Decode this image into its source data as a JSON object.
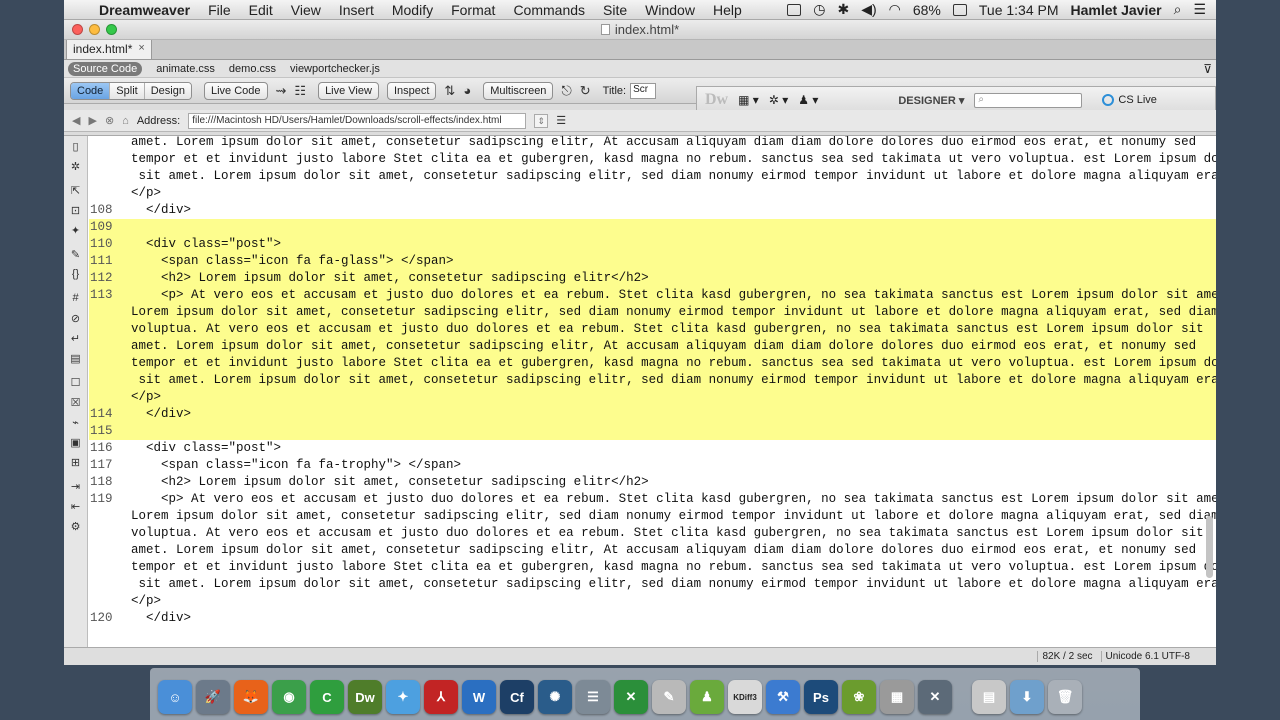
{
  "menubar": {
    "apple": "",
    "app": "Dreamweaver",
    "items": [
      "File",
      "Edit",
      "View",
      "Insert",
      "Modify",
      "Format",
      "Commands",
      "Site",
      "Window",
      "Help"
    ],
    "battery": "68%",
    "clock": "Tue 1:34 PM",
    "user": "Hamlet Javier"
  },
  "window": {
    "title": "index.html*",
    "tab": "index.html*",
    "tab_close": "×",
    "related_files": [
      "Source Code",
      "animate.css",
      "demo.css",
      "viewportchecker.js"
    ],
    "view_buttons": [
      "Code",
      "Split",
      "Design"
    ],
    "live_code": "Live Code",
    "live_view": "Live View",
    "inspect": "Inspect",
    "multiscreen": "Multiscreen",
    "title_label": "Title:",
    "title_value": "Scr",
    "address_label": "Address:",
    "address": "file:///Macintosh HD/Users/Hamlet/Downloads/scroll-effects/index.html"
  },
  "appbar": {
    "logo": "Dw",
    "workspace": "DESIGNER ▾",
    "search_placeholder": "",
    "cs_live": "CS Live"
  },
  "code_lines": [
    {
      "num": "",
      "text": "amet. Lorem ipsum dolor sit amet, consetetur sadipscing elitr, At accusam aliquyam diam diam dolore dolores duo eirmod eos erat, et nonumy sed",
      "hl": false,
      "cont": true
    },
    {
      "num": "",
      "text": "tempor et et invidunt justo labore Stet clita ea et gubergren, kasd magna no rebum. sanctus sea sed takimata ut vero voluptua. est Lorem ipsum dolor",
      "hl": false,
      "cont": true
    },
    {
      "num": "",
      "text": " sit amet. Lorem ipsum dolor sit amet, consetetur sadipscing elitr, sed diam nonumy eirmod tempor invidunt ut labore et dolore magna aliquyam erat.",
      "hl": false,
      "cont": true
    },
    {
      "num": "",
      "text": "</p>",
      "hl": false,
      "cont": true
    },
    {
      "num": "108",
      "text": "  </div>",
      "hl": false,
      "cont": false
    },
    {
      "num": "109",
      "text": "",
      "hl": true,
      "cont": false
    },
    {
      "num": "110",
      "text": "  <div class=\"post\">",
      "hl": true,
      "cont": false
    },
    {
      "num": "111",
      "text": "    <span class=\"icon fa fa-glass\"> </span>",
      "hl": true,
      "cont": false
    },
    {
      "num": "112",
      "text": "    <h2> Lorem ipsum dolor sit amet, consetetur sadipscing elitr</h2>",
      "hl": true,
      "cont": false
    },
    {
      "num": "113",
      "text": "    <p> At vero eos et accusam et justo duo dolores et ea rebum. Stet clita kasd gubergren, no sea takimata sanctus est Lorem ipsum dolor sit amet.",
      "hl": true,
      "cont": false
    },
    {
      "num": "",
      "text": "Lorem ipsum dolor sit amet, consetetur sadipscing elitr, sed diam nonumy eirmod tempor invidunt ut labore et dolore magna aliquyam erat, sed diam",
      "hl": true,
      "cont": true
    },
    {
      "num": "",
      "text": "voluptua. At vero eos et accusam et justo duo dolores et ea rebum. Stet clita kasd gubergren, no sea takimata sanctus est Lorem ipsum dolor sit",
      "hl": true,
      "cont": true
    },
    {
      "num": "",
      "text": "amet. Lorem ipsum dolor sit amet, consetetur sadipscing elitr, At accusam aliquyam diam diam dolore dolores duo eirmod eos erat, et nonumy sed",
      "hl": true,
      "cont": true
    },
    {
      "num": "",
      "text": "tempor et et invidunt justo labore Stet clita ea et gubergren, kasd magna no rebum. sanctus sea sed takimata ut vero voluptua. est Lorem ipsum dolor",
      "hl": true,
      "cont": true
    },
    {
      "num": "",
      "text": " sit amet. Lorem ipsum dolor sit amet, consetetur sadipscing elitr, sed diam nonumy eirmod tempor invidunt ut labore et dolore magna aliquyam erat.",
      "hl": true,
      "cont": true
    },
    {
      "num": "",
      "text": "</p>",
      "hl": true,
      "cont": true
    },
    {
      "num": "114",
      "text": "  </div>",
      "hl": true,
      "cont": false
    },
    {
      "num": "115",
      "text": "",
      "hl": true,
      "cont": false
    },
    {
      "num": "116",
      "text": "  <div class=\"post\">",
      "hl": false,
      "cont": false
    },
    {
      "num": "117",
      "text": "    <span class=\"icon fa fa-trophy\"> </span>",
      "hl": false,
      "cont": false
    },
    {
      "num": "118",
      "text": "    <h2> Lorem ipsum dolor sit amet, consetetur sadipscing elitr</h2>",
      "hl": false,
      "cont": false
    },
    {
      "num": "119",
      "text": "    <p> At vero eos et accusam et justo duo dolores et ea rebum. Stet clita kasd gubergren, no sea takimata sanctus est Lorem ipsum dolor sit amet.",
      "hl": false,
      "cont": false
    },
    {
      "num": "",
      "text": "Lorem ipsum dolor sit amet, consetetur sadipscing elitr, sed diam nonumy eirmod tempor invidunt ut labore et dolore magna aliquyam erat, sed diam",
      "hl": false,
      "cont": true
    },
    {
      "num": "",
      "text": "voluptua. At vero eos et accusam et justo duo dolores et ea rebum. Stet clita kasd gubergren, no sea takimata sanctus est Lorem ipsum dolor sit",
      "hl": false,
      "cont": true
    },
    {
      "num": "",
      "text": "amet. Lorem ipsum dolor sit amet, consetetur sadipscing elitr, At accusam aliquyam diam diam dolore dolores duo eirmod eos erat, et nonumy sed",
      "hl": false,
      "cont": true
    },
    {
      "num": "",
      "text": "tempor et et invidunt justo labore Stet clita ea et gubergren, kasd magna no rebum. sanctus sea sed takimata ut vero voluptua. est Lorem ipsum dolor",
      "hl": false,
      "cont": true
    },
    {
      "num": "",
      "text": " sit amet. Lorem ipsum dolor sit amet, consetetur sadipscing elitr, sed diam nonumy eirmod tempor invidunt ut labore et dolore magna aliquyam erat.",
      "hl": false,
      "cont": true
    },
    {
      "num": "",
      "text": "</p>",
      "hl": false,
      "cont": true
    },
    {
      "num": "120",
      "text": "  </div>",
      "hl": false,
      "cont": false
    }
  ],
  "status": {
    "size": "82K / 2 sec",
    "encoding": "Unicode 6.1 UTF-8"
  },
  "colors": {
    "highlight": "#fdfd8e",
    "tag": "#1a1a9a"
  },
  "dock": [
    {
      "name": "finder-icon",
      "glyph": "☺",
      "bg": "#4a8fd8"
    },
    {
      "name": "launchpad-icon",
      "glyph": "🚀",
      "bg": "#6c7a8a"
    },
    {
      "name": "firefox-icon",
      "glyph": "🦊",
      "bg": "#e8621a"
    },
    {
      "name": "chrome-icon",
      "glyph": "◉",
      "bg": "#3b9f4a"
    },
    {
      "name": "camtasia-icon",
      "glyph": "C",
      "bg": "#2f9e3e"
    },
    {
      "name": "dreamweaver-icon",
      "glyph": "Dw",
      "bg": "#4f7d2a"
    },
    {
      "name": "safari-icon",
      "glyph": "✦",
      "bg": "#4da0e0"
    },
    {
      "name": "acrobat-icon",
      "glyph": "⅄",
      "bg": "#c22424"
    },
    {
      "name": "word-icon",
      "glyph": "W",
      "bg": "#2b6fc1"
    },
    {
      "name": "coldfusion-icon",
      "glyph": "Cf",
      "bg": "#1d3f66"
    },
    {
      "name": "sourcetree-icon",
      "glyph": "✺",
      "bg": "#2a5c8a"
    },
    {
      "name": "database-icon",
      "glyph": "☰",
      "bg": "#7d8a96"
    },
    {
      "name": "excel-icon",
      "glyph": "✕",
      "bg": "#2b8f3a"
    },
    {
      "name": "preview-icon",
      "glyph": "✎",
      "bg": "#b9b9b9"
    },
    {
      "name": "android-icon",
      "glyph": "♟",
      "bg": "#6aaa3c"
    },
    {
      "name": "kdiff3-icon",
      "glyph": "KDiff3",
      "bg": "#d9d9d9"
    },
    {
      "name": "xcode-icon",
      "glyph": "⚒",
      "bg": "#3c7bd0"
    },
    {
      "name": "photoshop-icon",
      "glyph": "Ps",
      "bg": "#1d4b7a"
    },
    {
      "name": "kaleidoscope-icon",
      "glyph": "❀",
      "bg": "#6b9c2e"
    },
    {
      "name": "calculator-icon",
      "glyph": "▦",
      "bg": "#9a9a9a"
    },
    {
      "name": "migration-icon",
      "glyph": "✕",
      "bg": "#5c6a78"
    },
    {
      "name": "documents-stack-icon",
      "glyph": "▤",
      "bg": "#c8c8c8"
    },
    {
      "name": "downloads-stack-icon",
      "glyph": "⬇",
      "bg": "#6fa0cc"
    },
    {
      "name": "trash-icon",
      "glyph": "🗑",
      "bg": "#a9b0b8"
    }
  ]
}
